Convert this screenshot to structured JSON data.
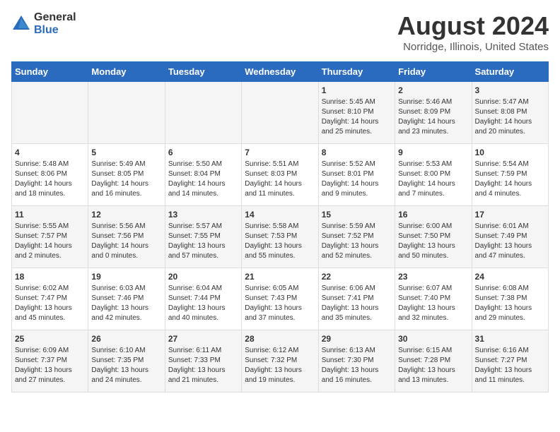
{
  "logo": {
    "general": "General",
    "blue": "Blue"
  },
  "title": "August 2024",
  "subtitle": "Norridge, Illinois, United States",
  "days_header": [
    "Sunday",
    "Monday",
    "Tuesday",
    "Wednesday",
    "Thursday",
    "Friday",
    "Saturday"
  ],
  "weeks": [
    [
      {
        "num": "",
        "content": ""
      },
      {
        "num": "",
        "content": ""
      },
      {
        "num": "",
        "content": ""
      },
      {
        "num": "",
        "content": ""
      },
      {
        "num": "1",
        "content": "Sunrise: 5:45 AM\nSunset: 8:10 PM\nDaylight: 14 hours and 25 minutes."
      },
      {
        "num": "2",
        "content": "Sunrise: 5:46 AM\nSunset: 8:09 PM\nDaylight: 14 hours and 23 minutes."
      },
      {
        "num": "3",
        "content": "Sunrise: 5:47 AM\nSunset: 8:08 PM\nDaylight: 14 hours and 20 minutes."
      }
    ],
    [
      {
        "num": "4",
        "content": "Sunrise: 5:48 AM\nSunset: 8:06 PM\nDaylight: 14 hours and 18 minutes."
      },
      {
        "num": "5",
        "content": "Sunrise: 5:49 AM\nSunset: 8:05 PM\nDaylight: 14 hours and 16 minutes."
      },
      {
        "num": "6",
        "content": "Sunrise: 5:50 AM\nSunset: 8:04 PM\nDaylight: 14 hours and 14 minutes."
      },
      {
        "num": "7",
        "content": "Sunrise: 5:51 AM\nSunset: 8:03 PM\nDaylight: 14 hours and 11 minutes."
      },
      {
        "num": "8",
        "content": "Sunrise: 5:52 AM\nSunset: 8:01 PM\nDaylight: 14 hours and 9 minutes."
      },
      {
        "num": "9",
        "content": "Sunrise: 5:53 AM\nSunset: 8:00 PM\nDaylight: 14 hours and 7 minutes."
      },
      {
        "num": "10",
        "content": "Sunrise: 5:54 AM\nSunset: 7:59 PM\nDaylight: 14 hours and 4 minutes."
      }
    ],
    [
      {
        "num": "11",
        "content": "Sunrise: 5:55 AM\nSunset: 7:57 PM\nDaylight: 14 hours and 2 minutes."
      },
      {
        "num": "12",
        "content": "Sunrise: 5:56 AM\nSunset: 7:56 PM\nDaylight: 14 hours and 0 minutes."
      },
      {
        "num": "13",
        "content": "Sunrise: 5:57 AM\nSunset: 7:55 PM\nDaylight: 13 hours and 57 minutes."
      },
      {
        "num": "14",
        "content": "Sunrise: 5:58 AM\nSunset: 7:53 PM\nDaylight: 13 hours and 55 minutes."
      },
      {
        "num": "15",
        "content": "Sunrise: 5:59 AM\nSunset: 7:52 PM\nDaylight: 13 hours and 52 minutes."
      },
      {
        "num": "16",
        "content": "Sunrise: 6:00 AM\nSunset: 7:50 PM\nDaylight: 13 hours and 50 minutes."
      },
      {
        "num": "17",
        "content": "Sunrise: 6:01 AM\nSunset: 7:49 PM\nDaylight: 13 hours and 47 minutes."
      }
    ],
    [
      {
        "num": "18",
        "content": "Sunrise: 6:02 AM\nSunset: 7:47 PM\nDaylight: 13 hours and 45 minutes."
      },
      {
        "num": "19",
        "content": "Sunrise: 6:03 AM\nSunset: 7:46 PM\nDaylight: 13 hours and 42 minutes."
      },
      {
        "num": "20",
        "content": "Sunrise: 6:04 AM\nSunset: 7:44 PM\nDaylight: 13 hours and 40 minutes."
      },
      {
        "num": "21",
        "content": "Sunrise: 6:05 AM\nSunset: 7:43 PM\nDaylight: 13 hours and 37 minutes."
      },
      {
        "num": "22",
        "content": "Sunrise: 6:06 AM\nSunset: 7:41 PM\nDaylight: 13 hours and 35 minutes."
      },
      {
        "num": "23",
        "content": "Sunrise: 6:07 AM\nSunset: 7:40 PM\nDaylight: 13 hours and 32 minutes."
      },
      {
        "num": "24",
        "content": "Sunrise: 6:08 AM\nSunset: 7:38 PM\nDaylight: 13 hours and 29 minutes."
      }
    ],
    [
      {
        "num": "25",
        "content": "Sunrise: 6:09 AM\nSunset: 7:37 PM\nDaylight: 13 hours and 27 minutes."
      },
      {
        "num": "26",
        "content": "Sunrise: 6:10 AM\nSunset: 7:35 PM\nDaylight: 13 hours and 24 minutes."
      },
      {
        "num": "27",
        "content": "Sunrise: 6:11 AM\nSunset: 7:33 PM\nDaylight: 13 hours and 21 minutes."
      },
      {
        "num": "28",
        "content": "Sunrise: 6:12 AM\nSunset: 7:32 PM\nDaylight: 13 hours and 19 minutes."
      },
      {
        "num": "29",
        "content": "Sunrise: 6:13 AM\nSunset: 7:30 PM\nDaylight: 13 hours and 16 minutes."
      },
      {
        "num": "30",
        "content": "Sunrise: 6:15 AM\nSunset: 7:28 PM\nDaylight: 13 hours and 13 minutes."
      },
      {
        "num": "31",
        "content": "Sunrise: 6:16 AM\nSunset: 7:27 PM\nDaylight: 13 hours and 11 minutes."
      }
    ]
  ]
}
